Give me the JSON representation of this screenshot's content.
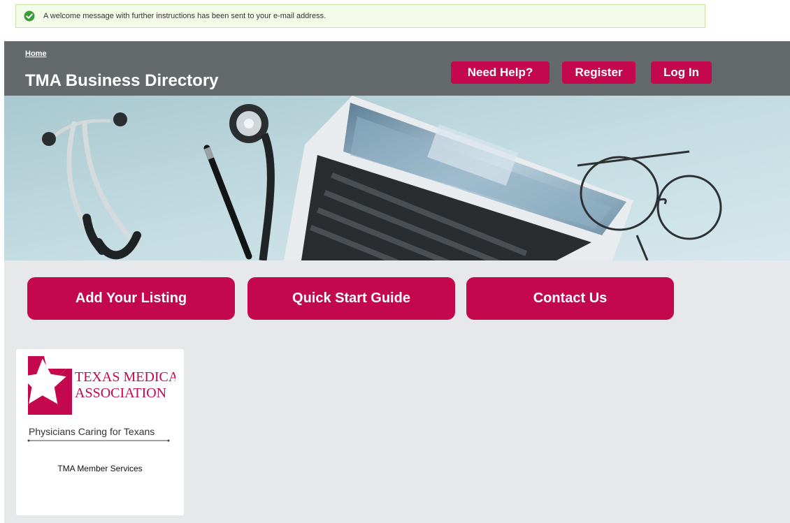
{
  "notice": {
    "message": "A welcome message with further instructions has been sent to your e-mail address."
  },
  "header": {
    "breadcrumb": "Home",
    "title": "TMA Business Directory",
    "buttons": {
      "help": "Need Help?",
      "register": "Register",
      "login": "Log In"
    }
  },
  "actions": {
    "add_listing": "Add Your Listing",
    "quick_start": "Quick Start Guide",
    "contact": "Contact Us"
  },
  "listing": {
    "logo_line1": "TEXAS MEDICAL",
    "logo_line2": "ASSOCIATION",
    "tagline": "Physicians Caring for Texans",
    "name": "TMA Member Services"
  },
  "colors": {
    "accent": "#c4084e",
    "header_bg": "#646a6c",
    "success": "#3c9c3c"
  },
  "icons": {
    "notice": "check-circle-icon",
    "hero": "stethoscope-laptop-glasses-photo"
  }
}
